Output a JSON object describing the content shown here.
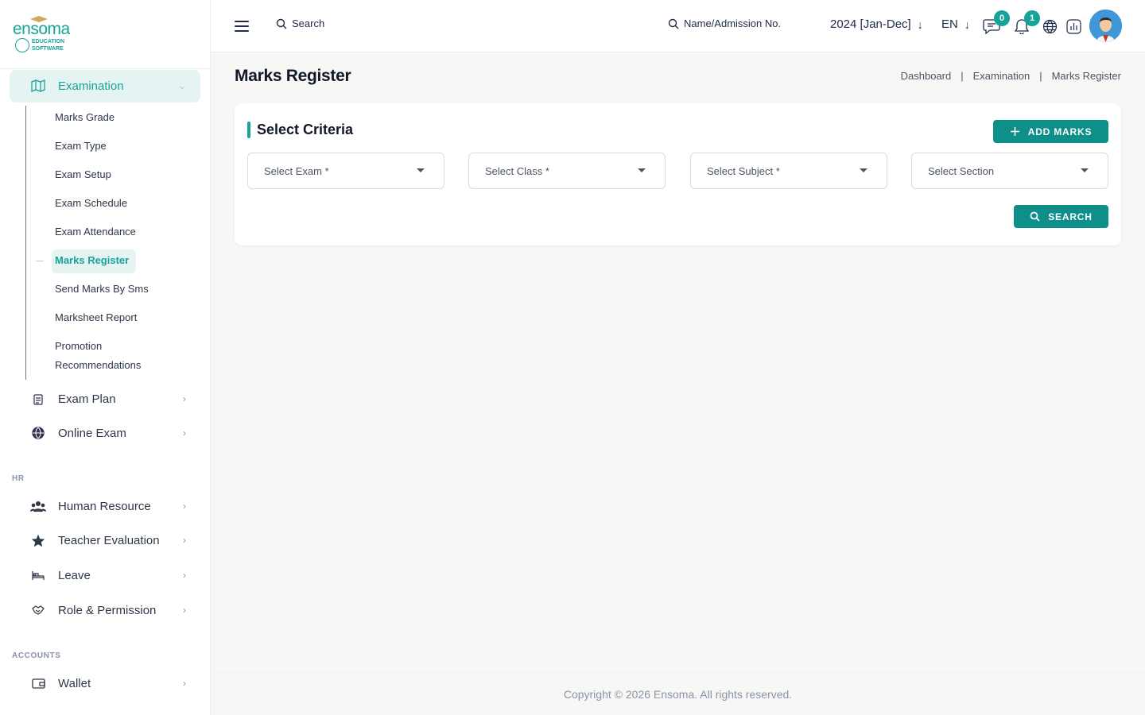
{
  "brand": {
    "name": "ensoma",
    "tagline_line1": "EDUCATION",
    "tagline_line2": "SOFTWARE",
    "accent_color": "#16a39a"
  },
  "header": {
    "search_label": "Search",
    "student_search_label": "Name/Admission No.",
    "session": "2024 [Jan-Dec]",
    "language": "EN",
    "messages_count": "0",
    "notifications_count": "1"
  },
  "sidebar": {
    "active_group": {
      "label": "Examination",
      "items": [
        "Marks Grade",
        "Exam Type",
        "Exam Setup",
        "Exam Schedule",
        "Exam Attendance",
        "Marks Register",
        "Send Marks By Sms",
        "Marksheet Report",
        "Promotion",
        "Recommendations"
      ],
      "active_item": "Marks Register"
    },
    "exam_items": [
      {
        "label": "Exam Plan",
        "icon": "clipboard-icon"
      },
      {
        "label": "Online Exam",
        "icon": "globe-icon"
      }
    ],
    "hr_label": "HR",
    "hr_items": [
      {
        "label": "Human Resource",
        "icon": "users-icon"
      },
      {
        "label": "Teacher Evaluation",
        "icon": "star-icon"
      },
      {
        "label": "Leave",
        "icon": "bed-icon"
      },
      {
        "label": "Role & Permission",
        "icon": "handshake-icon"
      }
    ],
    "accounts_label": "ACCOUNTS",
    "accounts_items": [
      {
        "label": "Wallet",
        "icon": "wallet-icon"
      }
    ]
  },
  "page": {
    "title": "Marks Register",
    "breadcrumb": [
      "Dashboard",
      "Examination",
      "Marks Register"
    ]
  },
  "criteria": {
    "title": "Select Criteria",
    "add_button": "ADD MARKS",
    "search_button": "SEARCH",
    "selects": [
      "Select Exam *",
      "Select Class *",
      "Select Subject *",
      "Select Section"
    ]
  },
  "footer": {
    "copyright": "Copyright © 2026 Ensoma. All rights reserved."
  }
}
